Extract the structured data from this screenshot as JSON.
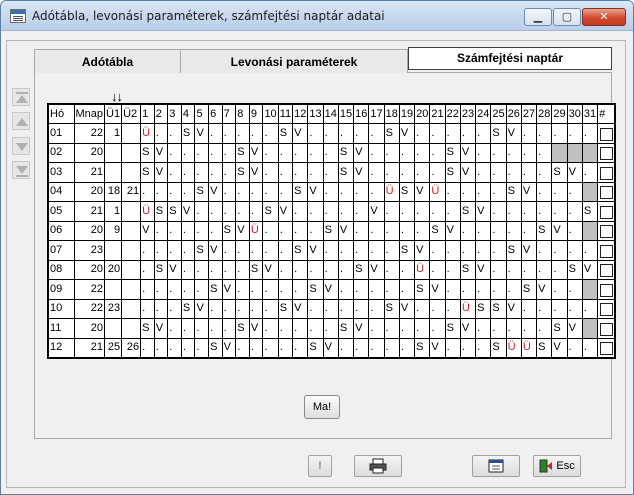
{
  "window": {
    "title": "Adótábla, levonási paraméterek, számfejtési naptár adatai"
  },
  "tabs": [
    {
      "label": "Adótábla"
    },
    {
      "label": "Levonási paraméterek"
    },
    {
      "label": "Számfejtési naptár"
    }
  ],
  "arrow_markers": "↓↓",
  "table": {
    "headers": [
      "Hó",
      "Mnap",
      "Ü1",
      "Ü2",
      "1",
      "2",
      "3",
      "4",
      "5",
      "6",
      "7",
      "8",
      "9",
      "10",
      "11",
      "12",
      "13",
      "14",
      "15",
      "16",
      "17",
      "18",
      "19",
      "20",
      "21",
      "22",
      "23",
      "24",
      "25",
      "26",
      "27",
      "28",
      "29",
      "30",
      "31",
      "#"
    ],
    "rows": [
      {
        "cells": [
          "01",
          "22",
          "1",
          "",
          "Ü",
          ".",
          ".",
          "S",
          "V",
          ".",
          ".",
          ".",
          ".",
          ".",
          "S",
          "V",
          ".",
          ".",
          ".",
          ".",
          ".",
          "S",
          "V",
          ".",
          ".",
          ".",
          ".",
          ".",
          "S",
          "V",
          ".",
          ".",
          ".",
          ".",
          "."
        ],
        "gray": []
      },
      {
        "cells": [
          "02",
          "20",
          "",
          "",
          "S",
          "V",
          ".",
          ".",
          ".",
          ".",
          ".",
          "S",
          "V",
          ".",
          ".",
          ".",
          ".",
          ".",
          "S",
          "V",
          ".",
          ".",
          ".",
          ".",
          ".",
          "S",
          "V",
          ".",
          ".",
          ".",
          ".",
          ".",
          "",
          "",
          ""
        ],
        "gray": [
          32,
          33,
          34
        ]
      },
      {
        "cells": [
          "03",
          "21",
          "",
          "",
          "S",
          "V",
          ".",
          ".",
          ".",
          ".",
          ".",
          "S",
          "V",
          ".",
          ".",
          ".",
          ".",
          ".",
          "S",
          "V",
          ".",
          ".",
          ".",
          ".",
          ".",
          "S",
          "V",
          ".",
          ".",
          ".",
          ".",
          ".",
          "S",
          "V",
          "."
        ],
        "gray": []
      },
      {
        "cells": [
          "04",
          "20",
          "18",
          "21",
          ".",
          ".",
          ".",
          ".",
          "S",
          "V",
          ".",
          ".",
          ".",
          ".",
          ".",
          "S",
          "V",
          ".",
          ".",
          ".",
          ".",
          "Ü",
          "S",
          "V",
          "Ü",
          ".",
          ".",
          ".",
          ".",
          "S",
          "V",
          ".",
          ".",
          ".",
          ""
        ],
        "gray": [
          34
        ]
      },
      {
        "cells": [
          "05",
          "21",
          "1",
          "",
          "Ü",
          "S",
          "S",
          "V",
          ".",
          ".",
          ".",
          ".",
          ".",
          "S",
          "V",
          ".",
          ".",
          ".",
          ".",
          ".",
          "V",
          ".",
          ".",
          ".",
          ".",
          ".",
          "S",
          "V",
          ".",
          ".",
          ".",
          ".",
          ".",
          ".",
          "S"
        ],
        "gray": []
      },
      {
        "cells": [
          "06",
          "20",
          "9",
          "",
          "V",
          ".",
          ".",
          ".",
          ".",
          ".",
          "S",
          "V",
          "Ü",
          ".",
          ".",
          ".",
          ".",
          "S",
          "V",
          ".",
          ".",
          ".",
          ".",
          ".",
          "S",
          "V",
          ".",
          ".",
          ".",
          ".",
          ".",
          "S",
          "V",
          ".",
          ""
        ],
        "gray": [
          34
        ]
      },
      {
        "cells": [
          "07",
          "23",
          "",
          "",
          ".",
          ".",
          ".",
          ".",
          "S",
          "V",
          ".",
          ".",
          ".",
          ".",
          ".",
          "S",
          "V",
          ".",
          ".",
          ".",
          ".",
          ".",
          "S",
          "V",
          ".",
          ".",
          ".",
          ".",
          ".",
          "S",
          "V",
          ".",
          ".",
          ".",
          "."
        ],
        "gray": []
      },
      {
        "cells": [
          "08",
          "20",
          "20",
          "",
          ".",
          "S",
          "V",
          ".",
          ".",
          ".",
          ".",
          ".",
          "S",
          "V",
          ".",
          ".",
          ".",
          ".",
          ".",
          "S",
          "V",
          ".",
          ".",
          "Ü",
          ".",
          ".",
          "S",
          "V",
          ".",
          ".",
          ".",
          ".",
          ".",
          "S",
          "V"
        ],
        "gray": []
      },
      {
        "cells": [
          "09",
          "22",
          "",
          "",
          ".",
          ".",
          ".",
          ".",
          ".",
          "S",
          "V",
          ".",
          ".",
          ".",
          ".",
          ".",
          "S",
          "V",
          ".",
          ".",
          ".",
          ".",
          ".",
          "S",
          "V",
          ".",
          ".",
          ".",
          ".",
          ".",
          "S",
          "V",
          ".",
          ".",
          ""
        ],
        "gray": [
          34
        ]
      },
      {
        "cells": [
          "10",
          "22",
          "23",
          "",
          ".",
          ".",
          ".",
          "S",
          "V",
          ".",
          ".",
          ".",
          ".",
          ".",
          "S",
          "V",
          ".",
          ".",
          ".",
          ".",
          ".",
          "S",
          "V",
          ".",
          ".",
          ".",
          "Ü",
          "S",
          "S",
          "V",
          ".",
          ".",
          ".",
          ".",
          "."
        ],
        "gray": []
      },
      {
        "cells": [
          "11",
          "20",
          "",
          "",
          "S",
          "V",
          ".",
          ".",
          ".",
          ".",
          ".",
          "S",
          "V",
          ".",
          ".",
          ".",
          ".",
          ".",
          "S",
          "V",
          ".",
          ".",
          ".",
          ".",
          ".",
          "S",
          "V",
          ".",
          ".",
          ".",
          ".",
          ".",
          "S",
          "V",
          ""
        ],
        "gray": [
          34
        ]
      },
      {
        "cells": [
          "12",
          "21",
          "25",
          "26",
          ".",
          ".",
          ".",
          ".",
          ".",
          "S",
          "V",
          ".",
          ".",
          ".",
          ".",
          ".",
          "S",
          "V",
          ".",
          ".",
          ".",
          ".",
          ".",
          "S",
          "V",
          ".",
          ".",
          ".",
          "S",
          "Ü",
          "Ü",
          "S",
          "V",
          ".",
          "."
        ],
        "gray": []
      }
    ]
  },
  "buttons": {
    "today": "Ma!",
    "warn": "!",
    "print_icon": "printer-icon",
    "calendar_icon": "calendar-icon",
    "esc": "Esc"
  },
  "colors": {
    "holiday": "#d11f1f",
    "gray_cell": "#c0c0c0"
  }
}
